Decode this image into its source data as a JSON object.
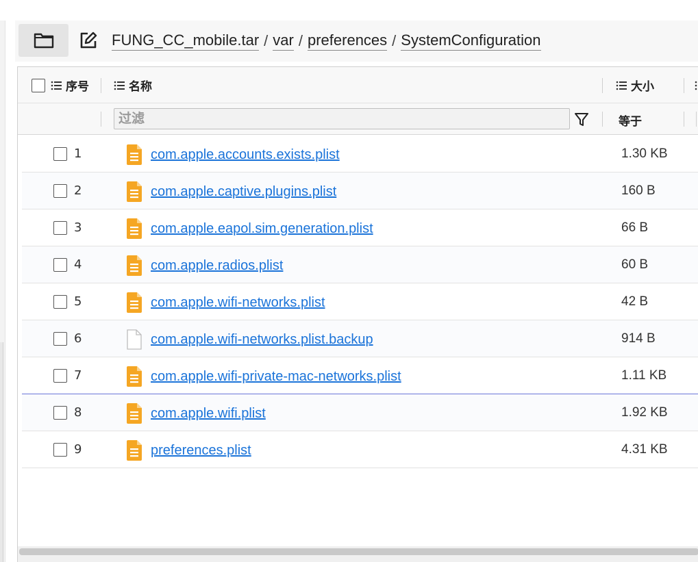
{
  "toolbar": {
    "breadcrumbs": [
      "FUNG_CC_mobile.tar",
      "var",
      "preferences",
      "SystemConfiguration"
    ],
    "separator": "/"
  },
  "header": {
    "col_index": "序号",
    "col_name": "名称",
    "col_size": "大小",
    "filter_placeholder": "过滤",
    "size_filter_op": "等于"
  },
  "icons": {
    "folder": "folder-icon",
    "edit": "edit-icon",
    "filter": "filter-icon",
    "list": "list-icon",
    "file": "file-icon",
    "blank_file": "blank-file-icon"
  },
  "colors": {
    "link": "#1a73d9",
    "plist_icon": "#f5a623",
    "selected_border": "#6a74d8"
  },
  "rows": [
    {
      "index": "1",
      "name": "com.apple.accounts.exists.plist",
      "size": "1.30 KB",
      "icon": "file-icon"
    },
    {
      "index": "2",
      "name": "com.apple.captive.plugins.plist",
      "size": "160 B",
      "icon": "file-icon"
    },
    {
      "index": "3",
      "name": "com.apple.eapol.sim.generation.plist",
      "size": "66 B",
      "icon": "file-icon"
    },
    {
      "index": "4",
      "name": "com.apple.radios.plist",
      "size": "60 B",
      "icon": "file-icon"
    },
    {
      "index": "5",
      "name": "com.apple.wifi-networks.plist",
      "size": "42 B",
      "icon": "file-icon"
    },
    {
      "index": "6",
      "name": "com.apple.wifi-networks.plist.backup",
      "size": "914 B",
      "icon": "blank-file-icon"
    },
    {
      "index": "7",
      "name": "com.apple.wifi-private-mac-networks.plist",
      "size": "1.11 KB",
      "icon": "file-icon"
    },
    {
      "index": "8",
      "name": "com.apple.wifi.plist",
      "size": "1.92 KB",
      "icon": "file-icon"
    },
    {
      "index": "9",
      "name": "preferences.plist",
      "size": "4.31 KB",
      "icon": "file-icon"
    }
  ]
}
